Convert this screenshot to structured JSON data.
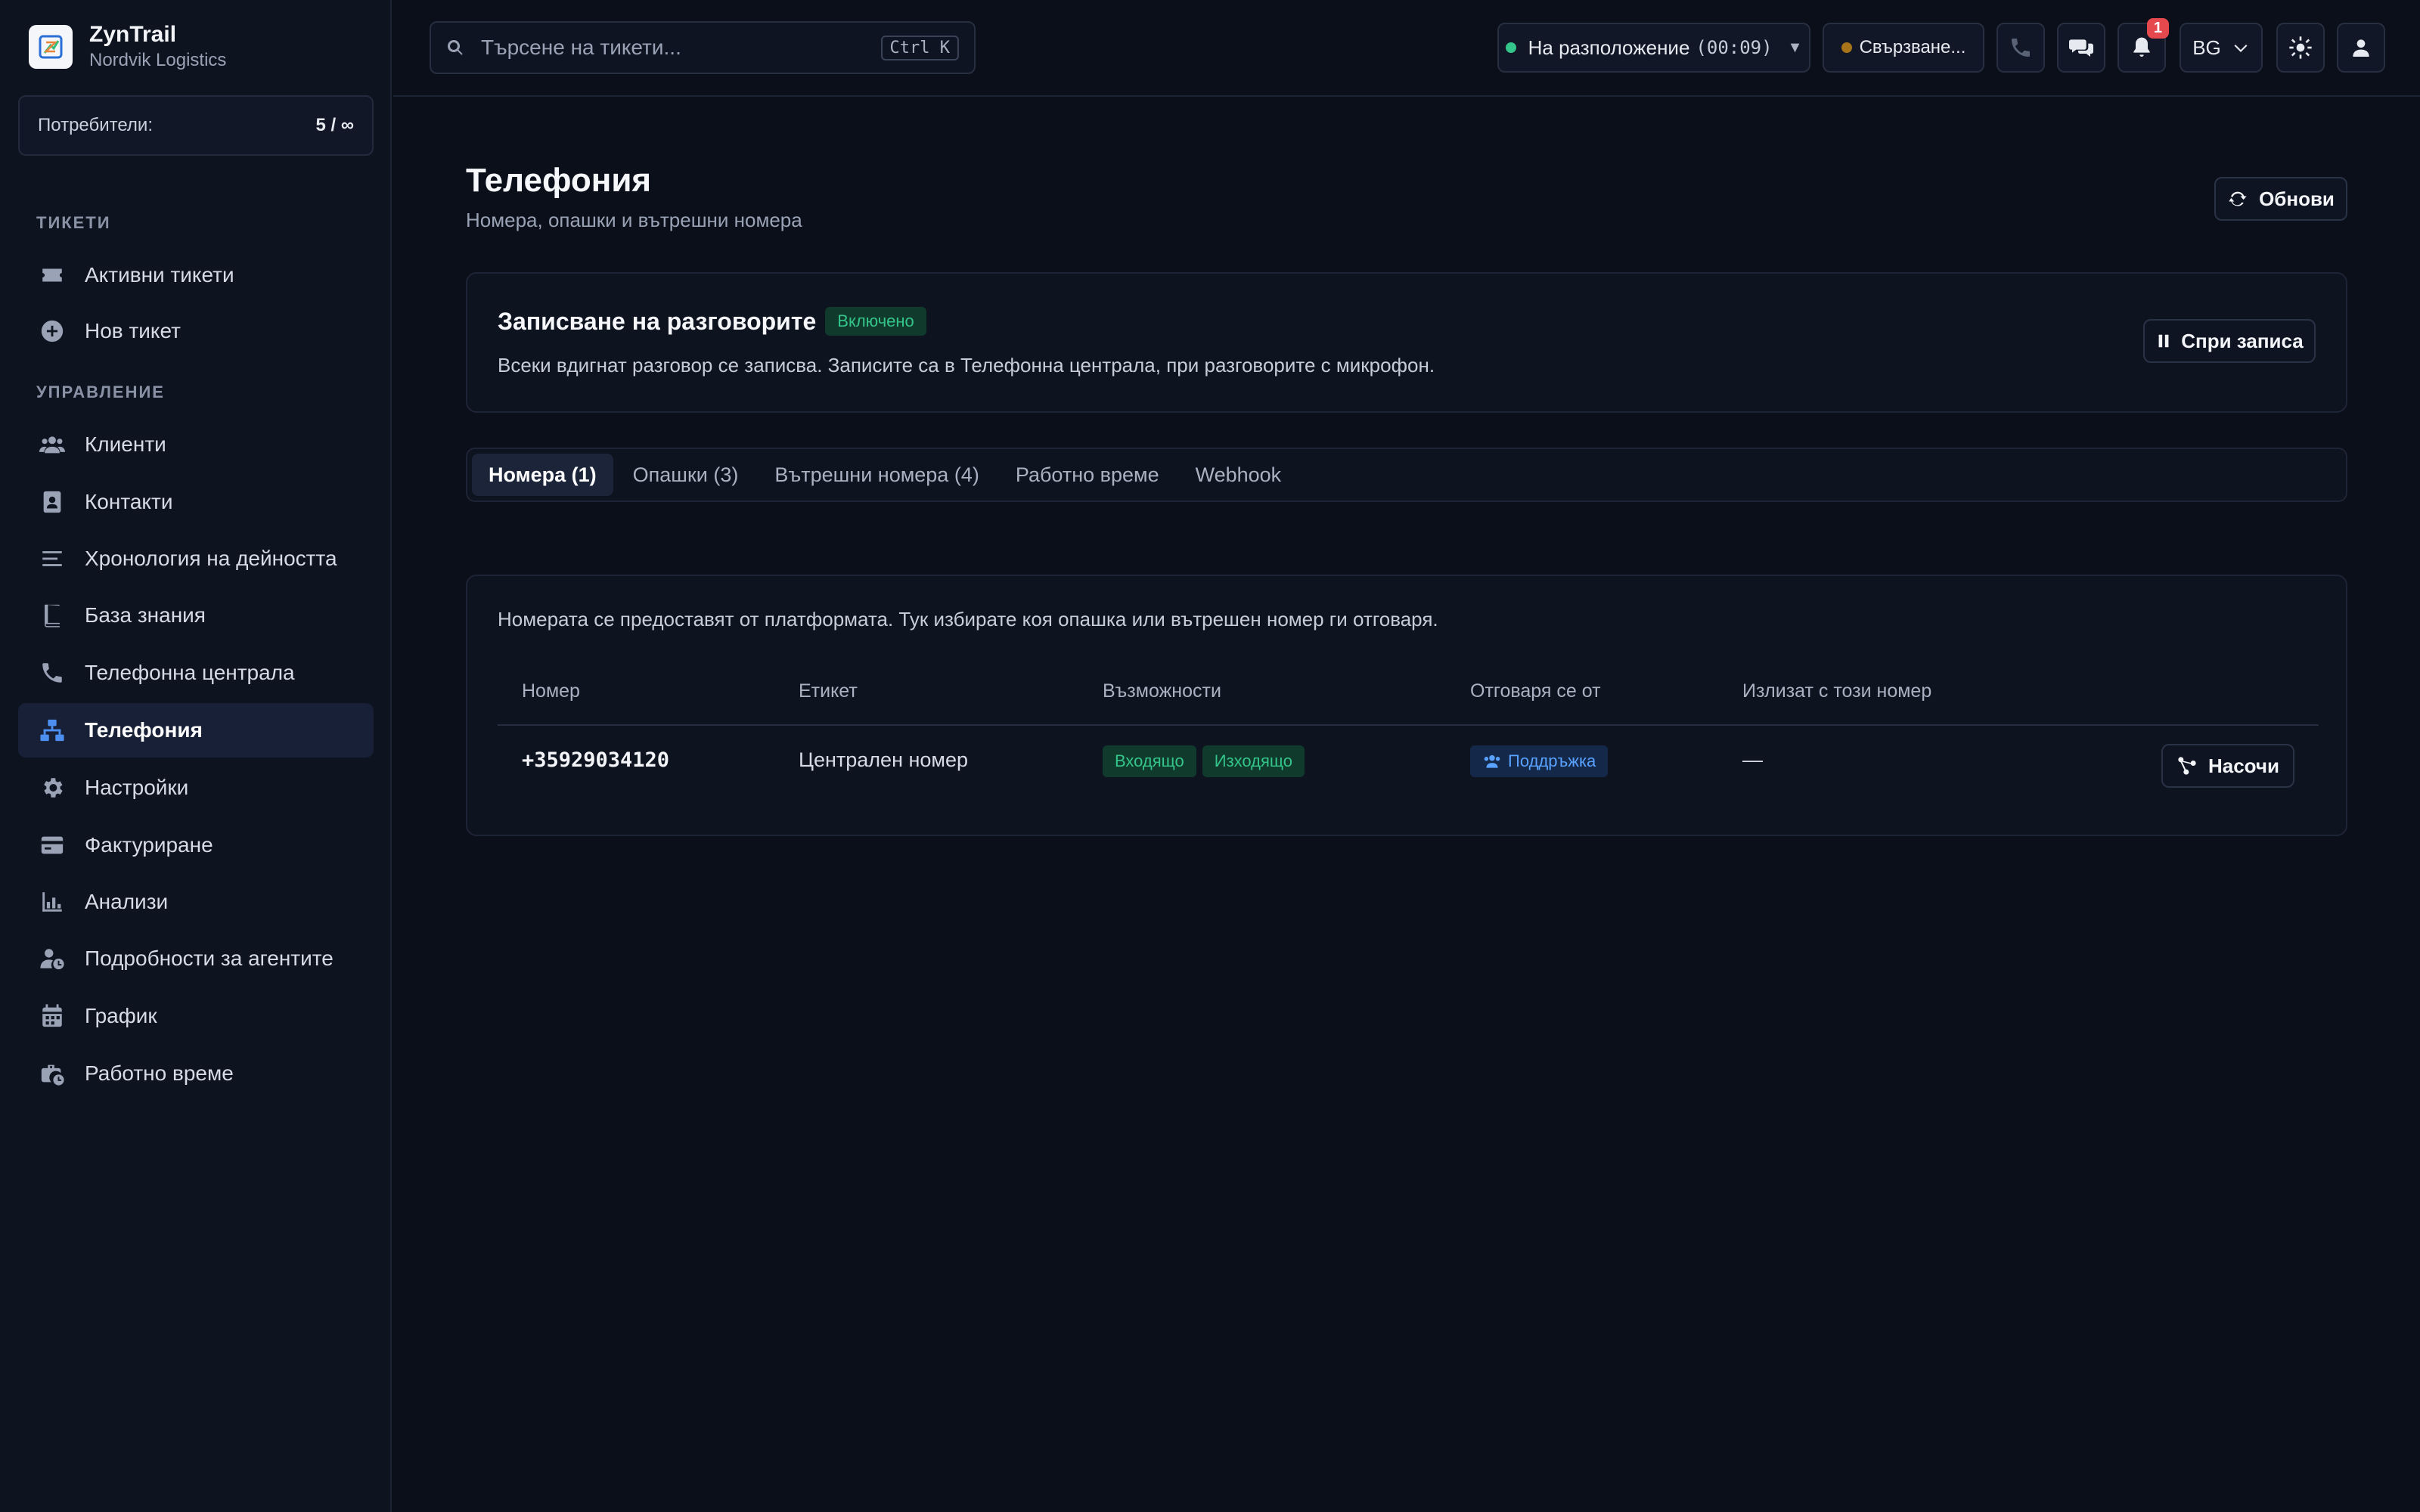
{
  "brand": {
    "name": "ZynTrail",
    "org": "Nordvik Logistics"
  },
  "users": {
    "label": "Потребители:",
    "value": "5 / ∞"
  },
  "sidebar": {
    "section_tickets": "ТИКЕТИ",
    "section_manage": "УПРАВЛЕНИЕ",
    "items": [
      {
        "label": "Активни тикети",
        "icon": "ticket-icon"
      },
      {
        "label": "Нов тикет",
        "icon": "plus-circle-icon"
      },
      {
        "label": "Клиенти",
        "icon": "users-icon"
      },
      {
        "label": "Контакти",
        "icon": "contact-card-icon"
      },
      {
        "label": "Хронология на дейността",
        "icon": "list-icon"
      },
      {
        "label": "База знания",
        "icon": "book-icon"
      },
      {
        "label": "Телефонна централа",
        "icon": "phone-icon"
      },
      {
        "label": "Телефония",
        "icon": "network-icon",
        "active": true
      },
      {
        "label": "Настройки",
        "icon": "gear-icon"
      },
      {
        "label": "Фактуриране",
        "icon": "credit-card-icon"
      },
      {
        "label": "Анализи",
        "icon": "bar-chart-icon"
      },
      {
        "label": "Подробности за агентите",
        "icon": "user-clock-icon"
      },
      {
        "label": "График",
        "icon": "calendar-icon"
      },
      {
        "label": "Работно време",
        "icon": "briefcase-clock-icon"
      }
    ]
  },
  "topbar": {
    "search_placeholder": "Търсене на тикети...",
    "search_shortcut": "Ctrl K",
    "status_label": "На разположение",
    "status_timer": "(00:09)",
    "connection_label": "Свързване...",
    "notifications_count": "1",
    "language": "BG",
    "colors": {
      "available": "#34c58a",
      "connecting": "#a8741a"
    }
  },
  "page": {
    "title": "Телефония",
    "subtitle": "Номера, опашки и вътрешни номера",
    "refresh_label": "Обнови"
  },
  "recording": {
    "title": "Записване на разговорите",
    "status": "Включено",
    "description": "Всеки вдигнат разговор се записва. Записите са в Телефонна централа, при разговорите с микрофон.",
    "stop_label": "Спри записа"
  },
  "tabs": [
    {
      "label": "Номера (1)",
      "active": true
    },
    {
      "label": "Опашки (3)"
    },
    {
      "label": "Вътрешни номера (4)"
    },
    {
      "label": "Работно време"
    },
    {
      "label": "Webhook"
    }
  ],
  "numbers": {
    "description": "Номерата се предоставят от платформата. Тук избирате коя опашка или вътрешен номер ги отговаря.",
    "columns": [
      "Номер",
      "Етикет",
      "Възможности",
      "Отговаря се от",
      "Излизат с този номер"
    ],
    "rows": [
      {
        "number": "+35929034120",
        "label": "Централен номер",
        "capabilities": [
          "Входящо",
          "Изходящо"
        ],
        "answered_by": "Поддръжка",
        "outbound": "—",
        "action": "Насочи"
      }
    ]
  }
}
